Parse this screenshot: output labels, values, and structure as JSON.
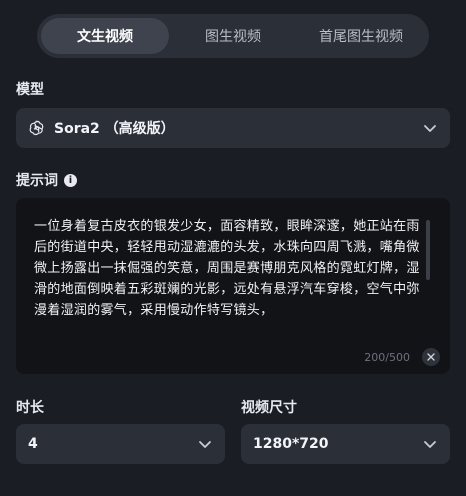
{
  "tabs": [
    {
      "label": "文生视频",
      "active": true
    },
    {
      "label": "图生视频",
      "active": false
    },
    {
      "label": "首尾图生视频",
      "active": false
    }
  ],
  "model": {
    "label": "模型",
    "selected": "Sora2 （高级版）",
    "icon": "openai-icon"
  },
  "prompt": {
    "label": "提示词",
    "info_icon": "info-icon",
    "text": "一位身着复古皮衣的银发少女，面容精致，眼眸深邃，她正站在雨后的街道中央，轻轻甩动湿漉漉的头发，水珠向四周飞溅，嘴角微微上扬露出一抹倔强的笑意，周围是赛博朋克风格的霓虹灯牌，湿滑的地面倒映着五彩斑斓的光影，远处有悬浮汽车穿梭，空气中弥漫着湿润的雾气，采用慢动作特写镜头，",
    "counter": "200/500"
  },
  "duration": {
    "label": "时长",
    "selected": "4"
  },
  "size": {
    "label": "视频尺寸",
    "selected": "1280*720"
  },
  "colors": {
    "background": "#1a1d24",
    "panel": "#2b2f38",
    "active_tab": "#3e434e",
    "prompt_bg": "#111317"
  }
}
